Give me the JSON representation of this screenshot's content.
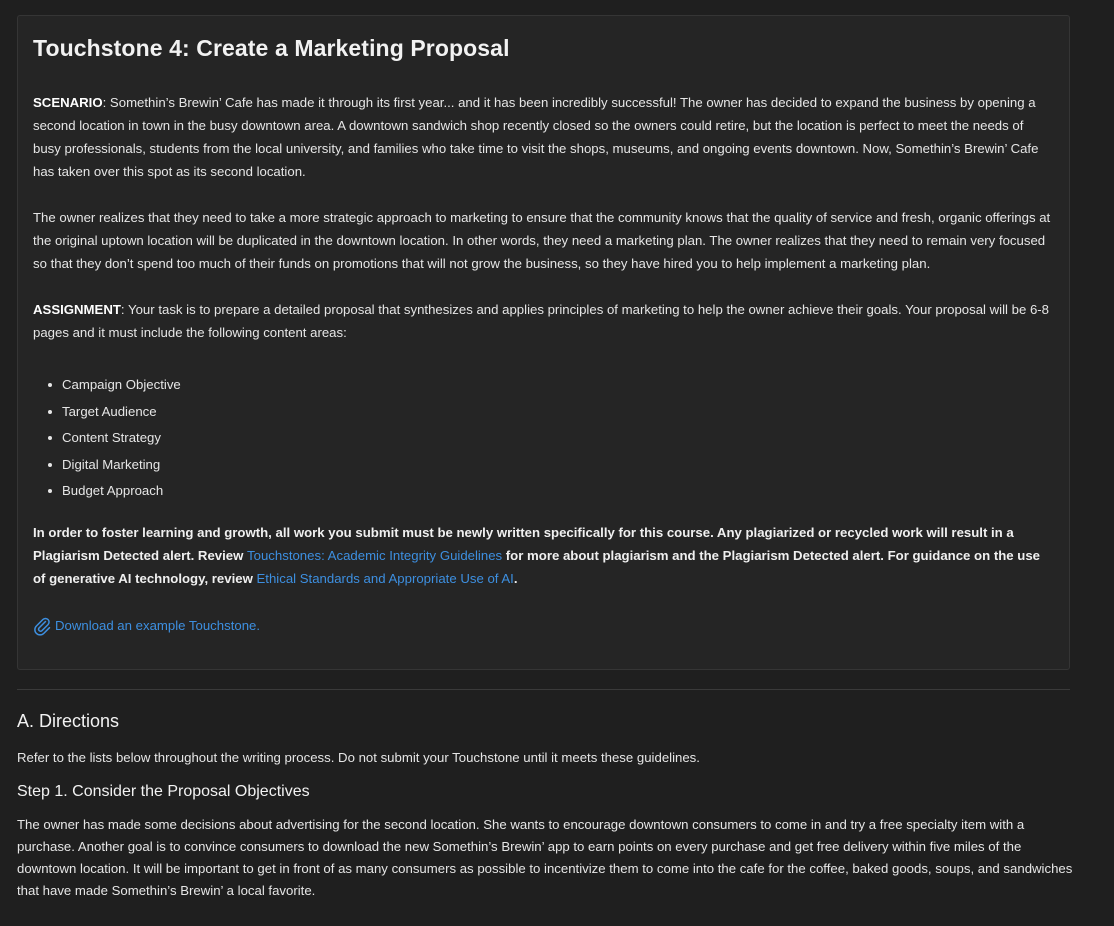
{
  "card": {
    "title": "Touchstone 4: Create a Marketing Proposal",
    "scenario_label": "SCENARIO",
    "scenario_text": ": Somethin’s Brewin’ Cafe has made it through its first year... and it has been incredibly successful! The owner has decided to expand the business by opening a second location in town in the busy downtown area. A downtown sandwich shop recently closed so the owners could retire, but the location is perfect to meet the needs of busy professionals, students from the local university, and families who take time to visit the shops, museums, and ongoing events downtown. Now, Somethin’s Brewin’ Cafe has taken over this spot as its second location.",
    "paragraph2": "The owner realizes that they need to take a more strategic approach to marketing to ensure that the community knows that the quality of service and fresh, organic offerings at the original uptown location will be duplicated in the downtown location. In other words, they need a marketing plan. The owner realizes that they need to remain very focused so that they don’t spend too much of their funds on promotions that will not grow the business, so they have hired you to help implement a marketing plan.",
    "assignment_label": "ASSIGNMENT",
    "assignment_text": ": Your task is to prepare a detailed proposal that synthesizes and applies principles of marketing to help the owner achieve their goals. Your proposal will be 6-8 pages and it must include the following content areas:",
    "content_areas": [
      "Campaign Objective",
      "Target Audience",
      "Content Strategy",
      "Digital Marketing",
      "Budget Approach"
    ],
    "integrity_text_1": "In order to foster learning and growth, all work you submit must be newly written specifically for this course. Any plagiarized or recycled work will result in a Plagiarism Detected alert. Review ",
    "integrity_link_1": "Touchstones: Academic Integrity Guidelines",
    "integrity_text_2": " for more about plagiarism and the Plagiarism Detected alert. For guidance on the use of generative AI technology, review ",
    "integrity_link_2": "Ethical Standards and Appropriate Use of AI",
    "integrity_text_3": ".",
    "download_link": "Download an example Touchstone.",
    "download_icon": "paperclip-icon",
    "link_color": "#3d8fe0"
  },
  "directions": {
    "heading": "A. Directions",
    "intro": "Refer to the lists below throughout the writing process. Do not submit your Touchstone until it meets these guidelines.",
    "step1_heading": "Step 1. Consider the Proposal Objectives",
    "step1_body": "The owner has made some decisions about advertising for the second location. She wants to encourage downtown consumers to come in and try a free specialty item with a purchase. Another goal is to convince consumers to download the new Somethin’s Brewin’ app to earn points on every purchase and get free delivery within five miles of the downtown location. It will be important to get in front of as many consumers as possible to incentivize them to come into the cafe for the coffee, baked goods, soups, and sandwiches that have made Somethin’s Brewin’ a local favorite."
  }
}
